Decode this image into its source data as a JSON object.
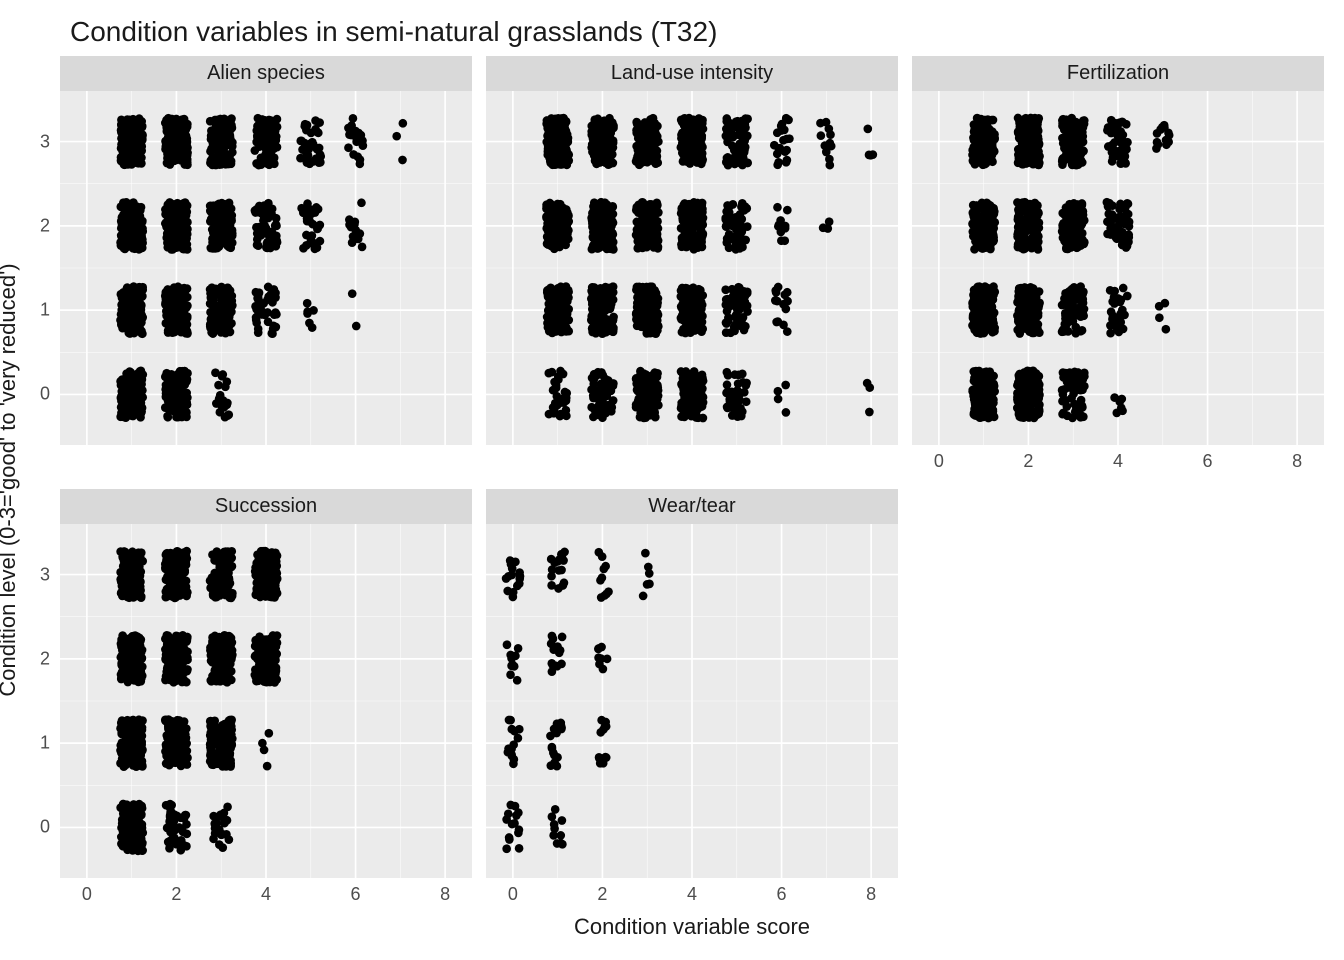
{
  "title": "Condition variables in semi-natural grasslands (T32)",
  "ylabel": "Condition level (0-3='good' to 'very reduced')",
  "xlabel": "Condition variable score",
  "x_ticks": [
    0,
    2,
    4,
    6,
    8
  ],
  "y_ticks": [
    0,
    1,
    2,
    3
  ],
  "xlim": [
    -0.6,
    8.6
  ],
  "ylim": [
    -0.6,
    3.6
  ],
  "jitter": {
    "x_half": 0.25,
    "y_half": 0.28,
    "radius": 4.2
  },
  "chart_data": [
    {
      "type": "scatter",
      "name": "Alien species",
      "y_axis_visible": true,
      "x_axis_visible": false,
      "clusters": [
        {
          "x": 1,
          "y": 0,
          "n": 160
        },
        {
          "x": 2,
          "y": 0,
          "n": 120
        },
        {
          "x": 3,
          "y": 0,
          "n": 20
        },
        {
          "x": 1,
          "y": 1,
          "n": 160
        },
        {
          "x": 2,
          "y": 1,
          "n": 140
        },
        {
          "x": 3,
          "y": 1,
          "n": 120
        },
        {
          "x": 4,
          "y": 1,
          "n": 40
        },
        {
          "x": 5,
          "y": 1,
          "n": 6
        },
        {
          "x": 6,
          "y": 1,
          "n": 2
        },
        {
          "x": 1,
          "y": 2,
          "n": 160
        },
        {
          "x": 2,
          "y": 2,
          "n": 150
        },
        {
          "x": 3,
          "y": 2,
          "n": 130
        },
        {
          "x": 4,
          "y": 2,
          "n": 60
        },
        {
          "x": 5,
          "y": 2,
          "n": 30
        },
        {
          "x": 6,
          "y": 2,
          "n": 12
        },
        {
          "x": 1,
          "y": 3,
          "n": 160
        },
        {
          "x": 2,
          "y": 3,
          "n": 150
        },
        {
          "x": 3,
          "y": 3,
          "n": 140
        },
        {
          "x": 4,
          "y": 3,
          "n": 90
        },
        {
          "x": 5,
          "y": 3,
          "n": 40
        },
        {
          "x": 6,
          "y": 3,
          "n": 18
        },
        {
          "x": 7,
          "y": 3,
          "n": 3
        }
      ]
    },
    {
      "type": "scatter",
      "name": "Land-use intensity",
      "y_axis_visible": false,
      "x_axis_visible": false,
      "clusters": [
        {
          "x": 1,
          "y": 0,
          "n": 30
        },
        {
          "x": 2,
          "y": 0,
          "n": 60
        },
        {
          "x": 3,
          "y": 0,
          "n": 120
        },
        {
          "x": 4,
          "y": 0,
          "n": 150
        },
        {
          "x": 5,
          "y": 0,
          "n": 40
        },
        {
          "x": 6,
          "y": 0,
          "n": 4
        },
        {
          "x": 8,
          "y": 0,
          "n": 3
        },
        {
          "x": 1,
          "y": 1,
          "n": 140
        },
        {
          "x": 2,
          "y": 1,
          "n": 150
        },
        {
          "x": 3,
          "y": 1,
          "n": 150
        },
        {
          "x": 4,
          "y": 1,
          "n": 140
        },
        {
          "x": 5,
          "y": 1,
          "n": 60
        },
        {
          "x": 6,
          "y": 1,
          "n": 14
        },
        {
          "x": 1,
          "y": 2,
          "n": 150
        },
        {
          "x": 2,
          "y": 2,
          "n": 150
        },
        {
          "x": 3,
          "y": 2,
          "n": 150
        },
        {
          "x": 4,
          "y": 2,
          "n": 120
        },
        {
          "x": 5,
          "y": 2,
          "n": 60
        },
        {
          "x": 6,
          "y": 2,
          "n": 10
        },
        {
          "x": 7,
          "y": 2,
          "n": 3
        },
        {
          "x": 1,
          "y": 3,
          "n": 160
        },
        {
          "x": 2,
          "y": 3,
          "n": 150
        },
        {
          "x": 3,
          "y": 3,
          "n": 150
        },
        {
          "x": 4,
          "y": 3,
          "n": 130
        },
        {
          "x": 5,
          "y": 3,
          "n": 70
        },
        {
          "x": 6,
          "y": 3,
          "n": 20
        },
        {
          "x": 7,
          "y": 3,
          "n": 12
        },
        {
          "x": 8,
          "y": 3,
          "n": 4
        }
      ]
    },
    {
      "type": "scatter",
      "name": "Fertilization",
      "y_axis_visible": false,
      "x_axis_visible": true,
      "clusters": [
        {
          "x": 1,
          "y": 0,
          "n": 150
        },
        {
          "x": 2,
          "y": 0,
          "n": 140
        },
        {
          "x": 3,
          "y": 0,
          "n": 60
        },
        {
          "x": 4,
          "y": 0,
          "n": 6
        },
        {
          "x": 1,
          "y": 1,
          "n": 150
        },
        {
          "x": 2,
          "y": 1,
          "n": 140
        },
        {
          "x": 3,
          "y": 1,
          "n": 70
        },
        {
          "x": 4,
          "y": 1,
          "n": 30
        },
        {
          "x": 5,
          "y": 1,
          "n": 4
        },
        {
          "x": 1,
          "y": 2,
          "n": 150
        },
        {
          "x": 2,
          "y": 2,
          "n": 150
        },
        {
          "x": 3,
          "y": 2,
          "n": 130
        },
        {
          "x": 4,
          "y": 2,
          "n": 60
        },
        {
          "x": 1,
          "y": 3,
          "n": 150
        },
        {
          "x": 2,
          "y": 3,
          "n": 150
        },
        {
          "x": 3,
          "y": 3,
          "n": 130
        },
        {
          "x": 4,
          "y": 3,
          "n": 50
        },
        {
          "x": 5,
          "y": 3,
          "n": 14
        }
      ]
    },
    {
      "type": "scatter",
      "name": "Succession",
      "y_axis_visible": true,
      "x_axis_visible": true,
      "clusters": [
        {
          "x": 1,
          "y": 0,
          "n": 150
        },
        {
          "x": 2,
          "y": 0,
          "n": 40
        },
        {
          "x": 3,
          "y": 0,
          "n": 20
        },
        {
          "x": 1,
          "y": 1,
          "n": 150
        },
        {
          "x": 2,
          "y": 1,
          "n": 150
        },
        {
          "x": 3,
          "y": 1,
          "n": 140
        },
        {
          "x": 4,
          "y": 1,
          "n": 4
        },
        {
          "x": 1,
          "y": 2,
          "n": 150
        },
        {
          "x": 2,
          "y": 2,
          "n": 150
        },
        {
          "x": 3,
          "y": 2,
          "n": 150
        },
        {
          "x": 4,
          "y": 2,
          "n": 150
        },
        {
          "x": 1,
          "y": 3,
          "n": 150
        },
        {
          "x": 2,
          "y": 3,
          "n": 150
        },
        {
          "x": 3,
          "y": 3,
          "n": 150
        },
        {
          "x": 4,
          "y": 3,
          "n": 150
        }
      ]
    },
    {
      "type": "scatter",
      "name": "Wear/tear",
      "y_axis_visible": false,
      "x_axis_visible": true,
      "clusters": [
        {
          "x": 0,
          "y": 0,
          "n": 14
        },
        {
          "x": 1,
          "y": 0,
          "n": 10
        },
        {
          "x": 0,
          "y": 1,
          "n": 14
        },
        {
          "x": 1,
          "y": 1,
          "n": 16
        },
        {
          "x": 2,
          "y": 1,
          "n": 12
        },
        {
          "x": 0,
          "y": 2,
          "n": 12
        },
        {
          "x": 1,
          "y": 2,
          "n": 14
        },
        {
          "x": 2,
          "y": 2,
          "n": 8
        },
        {
          "x": 0,
          "y": 3,
          "n": 16
        },
        {
          "x": 1,
          "y": 3,
          "n": 16
        },
        {
          "x": 2,
          "y": 3,
          "n": 10
        },
        {
          "x": 3,
          "y": 3,
          "n": 6
        }
      ]
    }
  ]
}
